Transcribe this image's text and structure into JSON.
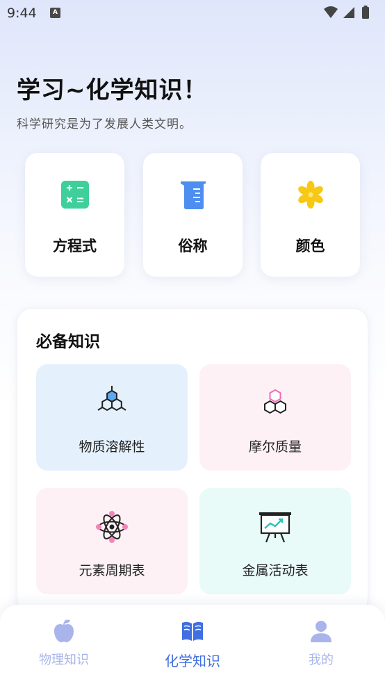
{
  "status_bar": {
    "time": "9:44",
    "notification_icon": "A"
  },
  "hero": {
    "title": "学习~化学知识！",
    "subtitle": "科学研究是为了发展人类文明。"
  },
  "quick_actions": [
    {
      "label": "方程式",
      "icon": "calculator-icon",
      "color": "#3ecf9a"
    },
    {
      "label": "俗称",
      "icon": "beaker-icon",
      "color": "#4d8ef0"
    },
    {
      "label": "颜色",
      "icon": "flower-icon",
      "color": "#f7c814"
    }
  ],
  "section": {
    "title": "必备知识",
    "tiles": [
      {
        "label": "物质溶解性",
        "icon": "hexagon-molecule-icon",
        "bg": "#e4f1fd"
      },
      {
        "label": "摩尔质量",
        "icon": "hexagon-cluster-icon",
        "bg": "#fdf1f5"
      },
      {
        "label": "元素周期表",
        "icon": "atom-icon",
        "bg": "#fdf1f5"
      },
      {
        "label": "金属活动表",
        "icon": "chart-board-icon",
        "bg": "#e8fbf8"
      }
    ]
  },
  "bottom_nav": {
    "items": [
      {
        "label": "物理知识",
        "icon": "apple-icon",
        "active": false
      },
      {
        "label": "化学知识",
        "icon": "book-icon",
        "active": true
      },
      {
        "label": "我的",
        "icon": "user-icon",
        "active": false
      }
    ],
    "active_color": "#3f6fe0",
    "inactive_color": "#a9b5ea"
  }
}
